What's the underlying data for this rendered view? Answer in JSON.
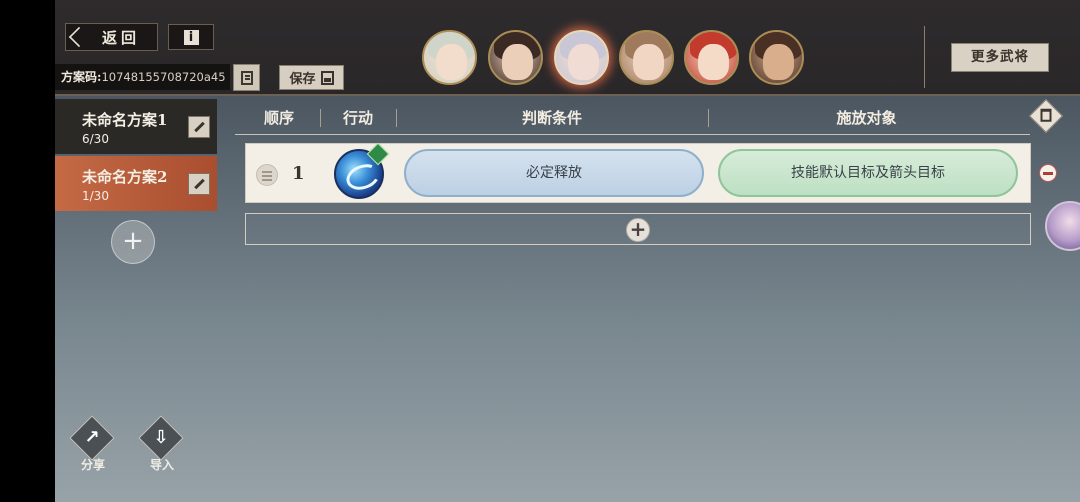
{
  "topbar": {
    "back_label": "返回",
    "info_label": "i",
    "plan_code_label": "方案码:",
    "plan_code_value": "10748155708720a45",
    "save_label": "保存",
    "more_generals_label": "更多武将"
  },
  "heroes": [
    {
      "id": "hero-1",
      "hair": "#cfd5c8",
      "face": "#f2dccb",
      "border": "#b08e57"
    },
    {
      "id": "hero-2",
      "hair": "#3b2a24",
      "face": "#eccfb8",
      "border": "#a98d55"
    },
    {
      "id": "hero-3",
      "hair": "#c9c7d6",
      "face": "#f0dcd2",
      "border": "#e8d7b6",
      "selected": true
    },
    {
      "id": "hero-4",
      "hair": "#a07a5c",
      "face": "#f1d6c3",
      "border": "#a98d55"
    },
    {
      "id": "hero-5",
      "hair": "#c23b2c",
      "face": "#f3dbc8",
      "border": "#a98d55"
    },
    {
      "id": "hero-6",
      "hair": "#4a3024",
      "face": "#d9ae8c",
      "border": "#a98d55"
    }
  ],
  "plans": [
    {
      "name": "未命名方案1",
      "count": "6/30"
    },
    {
      "name": "未命名方案2",
      "count": "1/30"
    }
  ],
  "add_plan_label": "+",
  "table": {
    "headers": {
      "order": "顺序",
      "action": "行动",
      "condition": "判断条件",
      "target": "施放对象"
    },
    "rows": [
      {
        "order": "1",
        "condition": "必定释放",
        "target": "技能默认目标及箭头目标"
      }
    ],
    "add_row_label": "+"
  },
  "bottom": {
    "share_label": "分享",
    "import_label": "导入"
  },
  "colors": {
    "accent_selected": "#b8583a",
    "condition_bg": "#c8d9ea",
    "target_bg": "#c9e6cd"
  }
}
